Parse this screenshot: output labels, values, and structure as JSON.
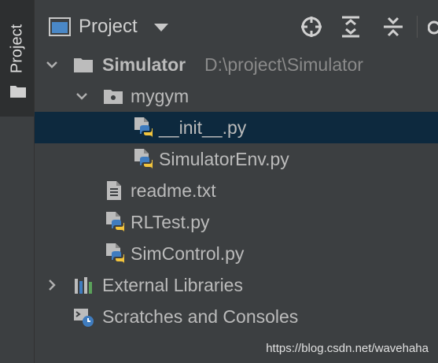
{
  "sidebar": {
    "tab_label": "Project",
    "tab_icon": "folder-icon"
  },
  "header": {
    "title": "Project",
    "buttons": [
      "locate-icon",
      "expand-all-icon",
      "collapse-all-icon"
    ]
  },
  "tree": {
    "root": {
      "label": "Simulator",
      "path": "D:\\project\\Simulator",
      "expanded": true
    },
    "mygym": {
      "label": "mygym",
      "expanded": true
    },
    "init_py": {
      "label": "__init__.py",
      "selected": true
    },
    "simulator_env": {
      "label": "SimulatorEnv.py"
    },
    "readme": {
      "label": "readme.txt"
    },
    "rltest": {
      "label": "RLTest.py"
    },
    "simcontrol": {
      "label": "SimControl.py"
    },
    "external_libraries": {
      "label": "External Libraries",
      "expanded": false
    },
    "scratches": {
      "label": "Scratches and Consoles"
    }
  },
  "colors": {
    "background": "#3c3f41",
    "selection": "#0d293e",
    "text": "#bbbbbb",
    "path_text": "#8a8a8a",
    "python_blue": "#3f7cbf",
    "python_yellow": "#f2c43d"
  },
  "watermark": "https://blog.csdn.net/wavehaha"
}
